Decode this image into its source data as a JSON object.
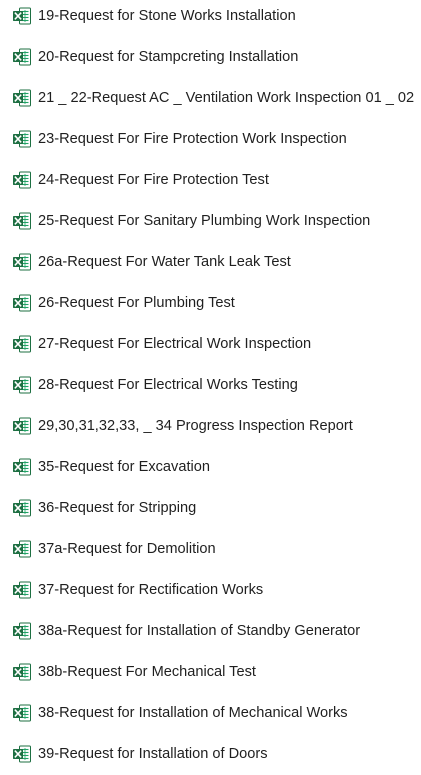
{
  "file_list": {
    "icon": "excel-spreadsheet-icon",
    "icon_colors": {
      "primary": "#1D6F42",
      "light": "#21A366",
      "sheet": "#E9F5EE"
    },
    "items": [
      {
        "name": "19-Request for Stone Works Installation"
      },
      {
        "name": "20-Request for Stampcreting Installation"
      },
      {
        "name": "21 _ 22-Request AC _ Ventilation Work Inspection 01 _ 02"
      },
      {
        "name": "23-Request For Fire Protection Work Inspection"
      },
      {
        "name": "24-Request For Fire Protection Test"
      },
      {
        "name": "25-Request For Sanitary Plumbing Work Inspection"
      },
      {
        "name": "26a-Request For Water Tank Leak Test"
      },
      {
        "name": "26-Request For Plumbing Test"
      },
      {
        "name": "27-Request For Electrical Work Inspection"
      },
      {
        "name": "28-Request For Electrical Works Testing"
      },
      {
        "name": "29,30,31,32,33, _ 34 Progress Inspection Report"
      },
      {
        "name": "35-Request for Excavation"
      },
      {
        "name": "36-Request for Stripping"
      },
      {
        "name": "37a-Request for Demolition"
      },
      {
        "name": "37-Request for Rectification Works"
      },
      {
        "name": "38a-Request for Installation of Standby Generator"
      },
      {
        "name": "38b-Request For Mechanical Test"
      },
      {
        "name": "38-Request for Installation of Mechanical Works"
      },
      {
        "name": "39-Request for Installation of Doors"
      }
    ]
  }
}
